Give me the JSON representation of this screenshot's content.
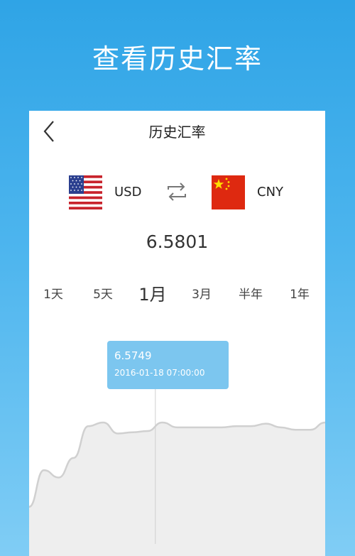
{
  "promo": {
    "title": "查看历史汇率"
  },
  "header": {
    "title": "历史汇率"
  },
  "currency": {
    "from": "USD",
    "to": "CNY"
  },
  "rate": {
    "current": "6.5801"
  },
  "periods": [
    {
      "label": "1天",
      "active": false
    },
    {
      "label": "5天",
      "active": false
    },
    {
      "label": "1月",
      "active": true
    },
    {
      "label": "3月",
      "active": false
    },
    {
      "label": "半年",
      "active": false
    },
    {
      "label": "1年",
      "active": false
    }
  ],
  "tooltip": {
    "value": "6.5749",
    "time": "2016-01-18 07:00:00"
  },
  "colors": {
    "accent": "#2fa4e6",
    "tooltip": "#7cc6ef",
    "line": "#d0d0d0",
    "area": "#eeeeee"
  },
  "icons": {
    "back": "chevron-left-icon",
    "swap": "swap-arrows-icon",
    "from_flag": "us-flag-icon",
    "to_flag": "cn-flag-icon"
  },
  "chart_data": {
    "type": "area",
    "values": [
      6.5705,
      6.5735,
      6.5729,
      6.5745,
      6.5771,
      6.5774,
      6.5765,
      6.5766,
      6.5767,
      6.5774,
      6.577,
      6.577,
      6.577,
      6.577,
      6.5771,
      6.5771,
      6.5773,
      6.577,
      6.5768,
      6.5768,
      6.5774
    ],
    "highlight_index": 8
  }
}
